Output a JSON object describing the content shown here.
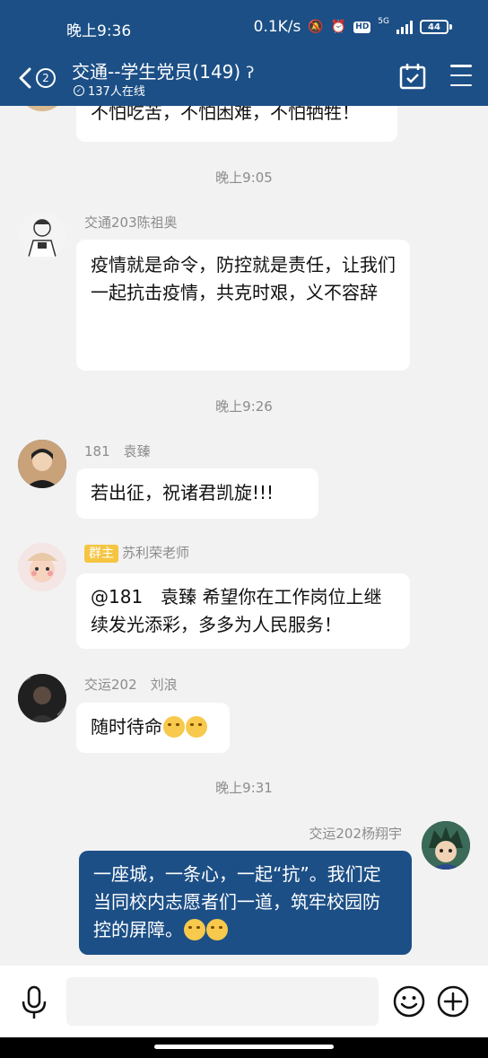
{
  "status_bar": {
    "time": "晚上9:36",
    "net_speed": "0.1K/s",
    "hd_label": "HD",
    "network": "5G",
    "battery": "44"
  },
  "header": {
    "back_count": "2",
    "title": "交通--学生党员(149)",
    "online": "137人在线"
  },
  "messages": {
    "m0": {
      "text": "不怕吃苦，不怕困难，不怕牺牲！"
    },
    "t1": "晚上9:05",
    "m1": {
      "sender": "交通203陈祖奥",
      "text": "疫情就是命令，防控就是责任，让我们一起抗击疫情，共克时艰，义不容辞"
    },
    "t2": "晚上9:26",
    "m2": {
      "sender": "181　袁臻",
      "text": "若出征，祝诸君凯旋!!!"
    },
    "m3": {
      "role": "群主",
      "sender": "苏利荣老师",
      "text": "@181　袁臻 希望你在工作岗位上继续发光添彩，多多为人民服务！"
    },
    "m4": {
      "sender": "交运202　刘浪",
      "text": "随时待命"
    },
    "t3": "晚上9:31",
    "m5": {
      "sender": "交运202杨翔宇",
      "text": "一座城，一条心，一起“抗”。我们定当同校内志愿者们一道，筑牢校园防控的屏障。"
    }
  },
  "colors": {
    "header_bg": "#1c4f86",
    "self_bubble": "#1c4f86",
    "chat_bg": "#f2f2f2",
    "role_tag": "#f5c542"
  },
  "icons": [
    "back-icon",
    "ear-icon",
    "calendar-check-icon",
    "menu-icon",
    "mic-icon",
    "emoji-icon",
    "plus-icon"
  ]
}
